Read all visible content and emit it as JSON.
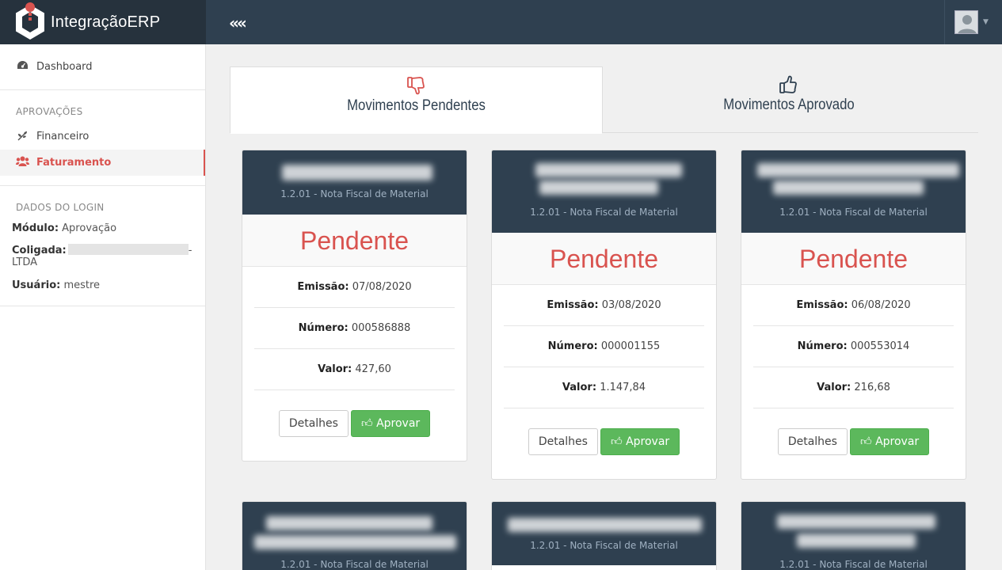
{
  "brand": {
    "name": "IntegraçãoERP"
  },
  "header": {
    "collapse_label": "«",
    "collapse_icon": "double-chevron-left-icon",
    "user_icon": "user-avatar-icon"
  },
  "sidebar": {
    "dashboard": "Dashboard",
    "section_approvals": "APROVAÇÕES",
    "financeiro": "Financeiro",
    "faturamento": "Faturamento",
    "section_login": "DADOS DO LOGIN",
    "modulo_label": "Módulo:",
    "modulo_value": "Aprovação",
    "coligada_label": "Coligada:",
    "coligada_value_suffix": "-",
    "coligada_value_line2": "LTDA",
    "usuario_label": "Usuário:",
    "usuario_value": "mestre"
  },
  "tabs": {
    "pending": {
      "label": "Movimentos Pendentes",
      "icon": "thumbs-down-icon",
      "color": "#d9534f"
    },
    "approved": {
      "label": "Movimentos Aprovado",
      "icon": "thumbs-up-icon"
    }
  },
  "labels": {
    "emissao": "Emissão:",
    "numero": "Número:",
    "valor": "Valor:",
    "detalhes": "Detalhes",
    "aprovar": "Aprovar"
  },
  "cards": [
    {
      "subtitle": "1.2.01 - Nota Fiscal de Material",
      "status": "Pendente",
      "emissao": "07/08/2020",
      "numero": "000586888",
      "valor": "427,60"
    },
    {
      "subtitle": "1.2.01 - Nota Fiscal de Material",
      "status": "Pendente",
      "emissao": "03/08/2020",
      "numero": "000001155",
      "valor": "1.147,84"
    },
    {
      "subtitle": "1.2.01 - Nota Fiscal de Material",
      "status": "Pendente",
      "emissao": "06/08/2020",
      "numero": "000553014",
      "valor": "216,68"
    }
  ],
  "cards_row2": [
    {
      "subtitle": "1.2.01 - Nota Fiscal de Material"
    },
    {
      "subtitle": "1.2.01 - Nota Fiscal de Material"
    },
    {
      "subtitle": "1.2.01 - Nota Fiscal de Material"
    }
  ],
  "colors": {
    "navbar": "#2f4050",
    "brand_bg": "#26323d",
    "danger": "#d9534f",
    "success": "#5cb85c"
  }
}
